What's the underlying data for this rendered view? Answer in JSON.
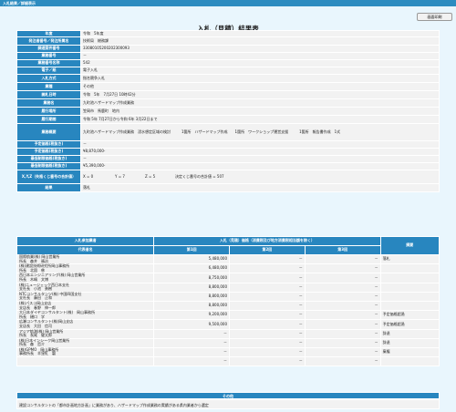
{
  "header": {
    "title": "入札結果／詳細表示",
    "print_button": "画面印刷"
  },
  "page_title": "入札（見積）結果表",
  "info_rows": [
    {
      "label": "年度",
      "value": "令和　5年度"
    },
    {
      "label": "発注者番号／発注所属名",
      "value": "技術局　総務課"
    },
    {
      "label": "調達案件番号",
      "value": "33080105200202300093"
    },
    {
      "label": "業務番号",
      "value": "－"
    },
    {
      "label": "業務番号名称",
      "value": "542"
    },
    {
      "label": "電子／紙",
      "value": "電子入札"
    },
    {
      "label": "入札方式",
      "value": "指名競争入札"
    },
    {
      "label": "業種",
      "value": "その他"
    },
    {
      "label": "開札日時",
      "value": "令和　5年　7月27日 10時42分"
    },
    {
      "label": "業務名",
      "value": "九町池ハザードマップ作成業務"
    },
    {
      "label": "履行場所",
      "value": "笠岡市　馬鹿町　地内"
    },
    {
      "label": "履行期間",
      "value": "令和 5年 7月27日から令和 6年 3月22日まで"
    },
    {
      "label": "業務概要",
      "value": "九町池ハザードマップ作成業務　浸水想定区域の検討　　　1箇所　ハザードマップ作成　　1箇所　ワークショップ運営支援　　　1箇所　報告書作成　1式"
    },
    {
      "label": "予定価格(税抜き)",
      "value": "－"
    },
    {
      "label": "予定価格(税抜き)",
      "value": "¥8,870,000-"
    },
    {
      "label": "最低制限価格(税抜き)",
      "value": "－"
    },
    {
      "label": "最低制限価格(税抜き)",
      "value": "¥5,390,000-"
    }
  ],
  "xyz_row": {
    "label": "X,Y,Z（失格くじ番号の合計値）",
    "x": "X = 0",
    "y": "Y = 7",
    "z": "Z = 5",
    "note": "決定くじ番号の合計値 = 507"
  },
  "result_row": {
    "label": "結果",
    "value": "落札"
  },
  "results": {
    "headers": {
      "company": "入札参加業者",
      "amount": "入札（見積）価格（消費税及び地方消費税相当額を除く）",
      "remarks": "摘要",
      "representative": "代表者名",
      "round1": "第1回",
      "round2": "第2回",
      "round3": "第3回"
    },
    "rows": [
      {
        "company": "国際航業(株) 岡山営業所",
        "rep": "所長　森井　晴治",
        "r1": "5,480,000",
        "r2": "－",
        "r3": "－",
        "note": "落札"
      },
      {
        "company": "(株)建設技術研究所岡山事務所",
        "rep": "所長　北園　慈",
        "r1": "6,480,000",
        "r2": "－",
        "r3": "－",
        "note": ""
      },
      {
        "company": "西日本エンジニアリング(株) 岡山営業所",
        "rep": "所長　木嶋　文博",
        "r1": "8,750,000",
        "r2": "－",
        "r3": "－",
        "note": ""
      },
      {
        "company": "(株)ニュージェック西日本支社",
        "rep": "支社長　小池　勇樹",
        "r1": "8,800,000",
        "r2": "－",
        "r3": "－",
        "note": ""
      },
      {
        "company": "NTCコンサルタンツ(株) 中国四国支社",
        "rep": "支社長　藤田　正和",
        "r1": "8,800,000",
        "r2": "－",
        "r3": "－",
        "note": ""
      },
      {
        "company": "(株)パスコ岡山支店",
        "rep": "支店長　春野　伸一郎",
        "r1": "8,800,000",
        "r2": "－",
        "r3": "－",
        "note": ""
      },
      {
        "company": "大日本ダイヤコンサルタント(株)　岡山事務所",
        "rep": "所長　樋口　学",
        "r1": "9,200,000",
        "r2": "－",
        "r3": "－",
        "note": "予定価格超過"
      },
      {
        "company": "広瀬コンサルタント(株)岡山支店",
        "rep": "支店長　大田　信司",
        "r1": "9,500,000",
        "r2": "－",
        "r3": "－",
        "note": "予定価格超過"
      },
      {
        "company": "アジア航測(株) 岡山営業所",
        "rep": "所長　長尾　健太郎",
        "r1": "－",
        "r2": "－",
        "r3": "－",
        "note": "辞退"
      },
      {
        "company": "(株)日本インシーク岡山営業所",
        "rep": "所長　森　哲介",
        "r1": "－",
        "r2": "－",
        "r3": "－",
        "note": "辞退"
      },
      {
        "company": "(株)GPMO　岡山事務所",
        "rep": "事務所長　羊窪紅　磐",
        "r1": "－",
        "r2": "－",
        "r3": "－",
        "note": "棄権"
      },
      {
        "company": "",
        "rep": "",
        "r1": "－",
        "r2": "－",
        "r3": "－",
        "note": ""
      }
    ]
  },
  "other": {
    "label": "その他",
    "text": "建設コンサルタントの「都市計画地方計画」に業務があり、ハザードマップ作成業務の実績がある県内業者から選定"
  }
}
